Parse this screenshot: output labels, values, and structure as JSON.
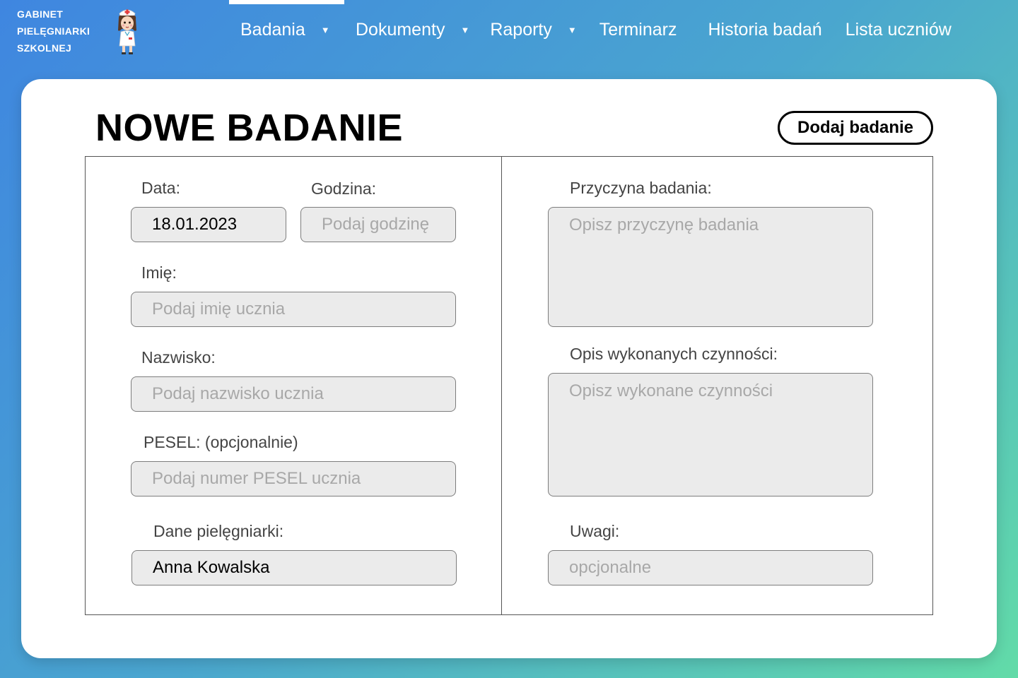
{
  "brand": {
    "line1": "GABINET",
    "line2": "PIELĘGNIARKI",
    "line3": "SZKOLNEJ"
  },
  "nav": {
    "items": [
      {
        "label": "Badania",
        "has_dropdown": true,
        "active": true
      },
      {
        "label": "Dokumenty",
        "has_dropdown": true,
        "active": false
      },
      {
        "label": "Raporty",
        "has_dropdown": true,
        "active": false
      },
      {
        "label": "Terminarz",
        "has_dropdown": false,
        "active": false
      },
      {
        "label": "Historia badań",
        "has_dropdown": false,
        "active": false
      },
      {
        "label": "Lista uczniów",
        "has_dropdown": false,
        "active": false
      }
    ],
    "caret": "▼"
  },
  "page": {
    "title": "NOWE BADANIE",
    "add_button": "Dodaj badanie"
  },
  "form": {
    "date": {
      "label": "Data:",
      "value": "18.01.2023"
    },
    "time": {
      "label": "Godzina:",
      "placeholder": "Podaj godzinę"
    },
    "first_name": {
      "label": "Imię:",
      "placeholder": "Podaj imię ucznia"
    },
    "last_name": {
      "label": "Nazwisko:",
      "placeholder": "Podaj nazwisko ucznia"
    },
    "pesel": {
      "label": "PESEL: (opcjonalnie)",
      "placeholder": "Podaj numer PESEL ucznia"
    },
    "nurse": {
      "label": "Dane pielęgniarki:",
      "value": "Anna Kowalska"
    },
    "reason": {
      "label": "Przyczyna badania:",
      "placeholder": "Opisz przyczynę badania"
    },
    "actions": {
      "label": "Opis wykonanych czynności:",
      "placeholder": "Opisz wykonane czynności"
    },
    "notes": {
      "label": "Uwagi:",
      "placeholder": "opcjonalne"
    }
  },
  "colors": {
    "gradient_start": "#3f86e0",
    "gradient_end": "#62dba8",
    "field_bg": "#ebebeb",
    "placeholder": "#a8a8a8"
  }
}
